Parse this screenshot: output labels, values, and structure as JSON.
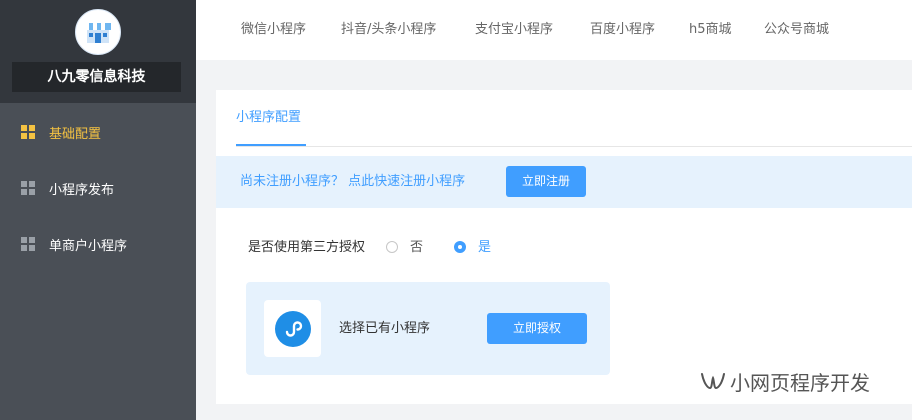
{
  "sidebar": {
    "brand_name": "八九零信息科技",
    "items": [
      {
        "label": "基础配置",
        "icon": "grid-icon",
        "active": true
      },
      {
        "label": "小程序发布",
        "icon": "grid-icon",
        "active": false
      },
      {
        "label": "单商户小程序",
        "icon": "grid-icon",
        "active": false
      }
    ]
  },
  "topbar": {
    "tabs": [
      "微信小程序",
      "抖音/头条小程序",
      "支付宝小程序",
      "百度小程序",
      "h5商城",
      "公众号商城"
    ]
  },
  "main": {
    "tab_label": "小程序配置",
    "banner": {
      "text": "尚未注册小程序？ 点此快速注册小程序",
      "button_label": "立即注册"
    },
    "auth": {
      "question": "是否使用第三方授权",
      "options": [
        {
          "label": "否",
          "selected": false
        },
        {
          "label": "是",
          "selected": true
        }
      ]
    },
    "miniprogram": {
      "text": "选择已有小程序",
      "button_label": "立即授权",
      "icon": "mini-program-icon"
    }
  },
  "watermark": {
    "text": "小网页程序开发",
    "icon": "wechat-channel-icon"
  },
  "colors": {
    "accent": "#409eff",
    "sidebar_bg": "#4a4f56",
    "active_nav": "#f5c342"
  }
}
